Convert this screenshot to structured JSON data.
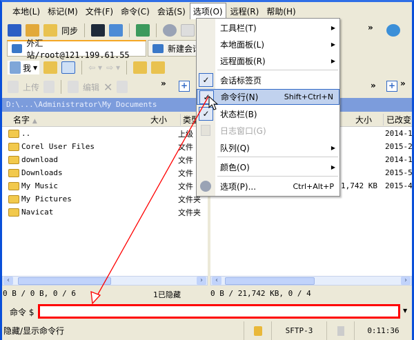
{
  "menubar": [
    "本地(L)",
    "标记(M)",
    "文件(F)",
    "命令(C)",
    "会话(S)",
    "选项(O)",
    "远程(R)",
    "帮助(H)"
  ],
  "toolbar": {
    "sync_label": "同步",
    "overflow": "»"
  },
  "tabs": [
    {
      "label": "外汇站/root@121.199.61.55"
    },
    {
      "label": "新建会话"
    }
  ],
  "local": {
    "drive_label": "我",
    "upload_label": "上传",
    "edit_label": "编辑",
    "path": "D:\\...\\Administrator\\My Documents",
    "columns": {
      "name": "名字",
      "size": "大小",
      "type": "类型"
    },
    "rows": [
      {
        "name": "..",
        "type": "上级"
      },
      {
        "name": "Corel User Files",
        "type": "文件"
      },
      {
        "name": "download",
        "type": "文件"
      },
      {
        "name": "Downloads",
        "type": "文件"
      },
      {
        "name": "My Music",
        "type": "文件"
      },
      {
        "name": "My Pictures",
        "type": "文件夹"
      },
      {
        "name": "Navicat",
        "type": "文件夹"
      }
    ],
    "status": "0 B / 0 B, 0 / 6",
    "hidden": "1已隐藏"
  },
  "remote": {
    "columns": {
      "size": "大小",
      "changed": "已改变"
    },
    "rows": [
      {
        "size": "",
        "changed": "2014-1"
      },
      {
        "size": "",
        "changed": "2015-2"
      },
      {
        "size": "",
        "changed": "2014-1"
      },
      {
        "size": "",
        "changed": "2015-5"
      },
      {
        "size": "1,742 KB",
        "changed": "2015-4"
      }
    ],
    "status": "0 B / 21,742 KB, 0 / 4"
  },
  "command": {
    "label": "命令 $",
    "value": ""
  },
  "options_menu": [
    {
      "label": "工具栏(T)",
      "submenu": true
    },
    {
      "label": "本地面板(L)",
      "submenu": true
    },
    {
      "label": "远程面板(R)",
      "submenu": true
    },
    {
      "label": "会话标签页",
      "checked": true
    },
    {
      "label": "命令行(N)",
      "shortcut": "Shift+Ctrl+N",
      "checked": true,
      "highlighted": true
    },
    {
      "label": "状态栏(B)",
      "checked": true
    },
    {
      "label": "日志窗口(G)",
      "disabled": true
    },
    {
      "label": "队列(Q)",
      "submenu": true
    },
    {
      "label": "颜色(O)",
      "submenu": true
    },
    {
      "label": "选项(P)...",
      "shortcut": "Ctrl+Alt+P"
    }
  ],
  "statusbar": {
    "hint": "隐藏/显示命令行",
    "protocol": "SFTP-3",
    "time": "0:11:36"
  },
  "colors": {
    "annotation": "#FF0000",
    "highlight": "#C1D2EE"
  }
}
